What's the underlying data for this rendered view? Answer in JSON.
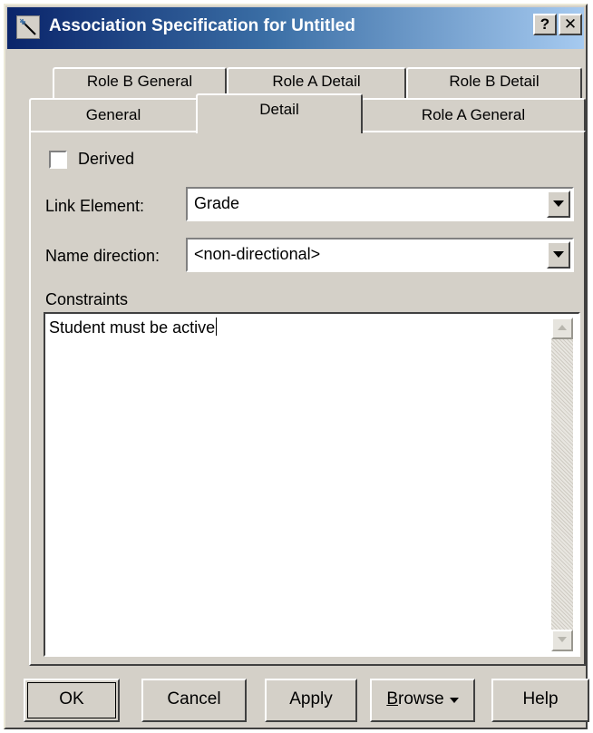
{
  "window": {
    "title": "Association Specification for Untitled",
    "help_glyph": "?",
    "close_glyph": "✕"
  },
  "tabs": {
    "back_row": [
      {
        "label": "Role B General"
      },
      {
        "label": "Role A Detail"
      },
      {
        "label": "Role B Detail"
      }
    ],
    "front_row": [
      {
        "label": "General"
      },
      {
        "label": "Detail"
      },
      {
        "label": "Role A General"
      }
    ],
    "active": "Detail"
  },
  "form": {
    "derived": {
      "label": "Derived",
      "checked": false
    },
    "link_element": {
      "label": "Link Element:",
      "value": "Grade"
    },
    "name_direction": {
      "label": "Name direction:",
      "value": "<non-directional>"
    },
    "constraints": {
      "label": "Constraints",
      "value": "Student must be active"
    }
  },
  "buttons": {
    "ok": "OK",
    "cancel": "Cancel",
    "apply": "Apply",
    "browse_first": "B",
    "browse_rest": "rowse",
    "help": "Help"
  },
  "icons": {
    "app": "magic-wand-icon",
    "dropdown": "down-arrow-icon",
    "scroll_up": "scroll-up-arrow-icon",
    "scroll_down": "scroll-down-arrow-icon",
    "browse_menu": "menu-down-arrow-icon"
  },
  "colors": {
    "title_bar_start": "#0a246a",
    "title_bar_end": "#a6caf0",
    "dialog_face": "#d4d0c8"
  }
}
